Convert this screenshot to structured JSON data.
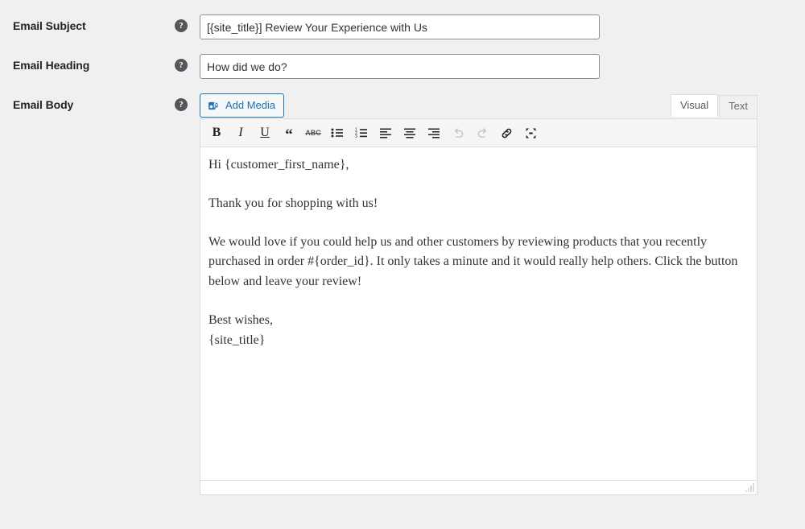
{
  "rows": [
    {
      "label": "Email Subject",
      "help_icon": "help-circle-icon",
      "help_glyph": "?",
      "value": "[{site_title}] Review Your Experience with Us",
      "placeholder": ""
    },
    {
      "label": "Email Heading",
      "help_icon": "help-circle-icon",
      "help_glyph": "?",
      "value": "How did we do?",
      "placeholder": ""
    },
    {
      "label": "Email Body",
      "help_icon": "help-circle-icon",
      "help_glyph": "?"
    }
  ],
  "editor": {
    "add_media_label": "Add Media",
    "add_media_icon": "insert-media-icon",
    "tabs": [
      {
        "label": "Visual",
        "active": true
      },
      {
        "label": "Text",
        "active": false
      }
    ],
    "toolbar": [
      {
        "name": "bold-button",
        "glyph": "B",
        "title": "Bold",
        "disabled": false
      },
      {
        "name": "italic-button",
        "glyph": "I",
        "title": "Italic",
        "disabled": false
      },
      {
        "name": "underline-button",
        "glyph": "U",
        "title": "Underline",
        "disabled": false
      },
      {
        "name": "blockquote-button",
        "glyph": "“",
        "title": "Blockquote",
        "disabled": false
      },
      {
        "name": "strikethrough-button",
        "glyph": "ABC",
        "title": "Strikethrough",
        "disabled": false
      },
      {
        "name": "bulleted-list-button",
        "glyph": "",
        "title": "Bulleted list",
        "disabled": false
      },
      {
        "name": "numbered-list-button",
        "glyph": "",
        "title": "Numbered list",
        "disabled": false
      },
      {
        "name": "align-left-button",
        "glyph": "",
        "title": "Align left",
        "disabled": false
      },
      {
        "name": "align-center-button",
        "glyph": "",
        "title": "Align center",
        "disabled": false
      },
      {
        "name": "align-right-button",
        "glyph": "",
        "title": "Align right",
        "disabled": false
      },
      {
        "name": "undo-button",
        "glyph": "",
        "title": "Undo",
        "disabled": true
      },
      {
        "name": "redo-button",
        "glyph": "",
        "title": "Redo",
        "disabled": true
      },
      {
        "name": "insert-link-button",
        "glyph": "",
        "title": "Insert/edit link",
        "disabled": false
      },
      {
        "name": "fullscreen-button",
        "glyph": "",
        "title": "Distraction-free writing mode",
        "disabled": false
      }
    ],
    "body_paragraphs": [
      "Hi {customer_first_name},",
      "Thank you for shopping with us!",
      "We would love if you could help us and other customers by reviewing products that you recently purchased in order #{order_id}. It only takes a minute and it would really help others. Click the button below and leave your review!",
      "Best wishes,"
    ],
    "signature_line": "{site_title}",
    "resize_handle_icon": "resize-grip-icon"
  },
  "colors": {
    "page_background": "#f0f0f1",
    "accent_blue": "#2271b1",
    "input_border": "#8c8f94",
    "editor_border": "#dcdcde",
    "toolbar_background": "#f5f5f5",
    "label_text": "#1d2327",
    "help_icon_background": "#50575e"
  }
}
